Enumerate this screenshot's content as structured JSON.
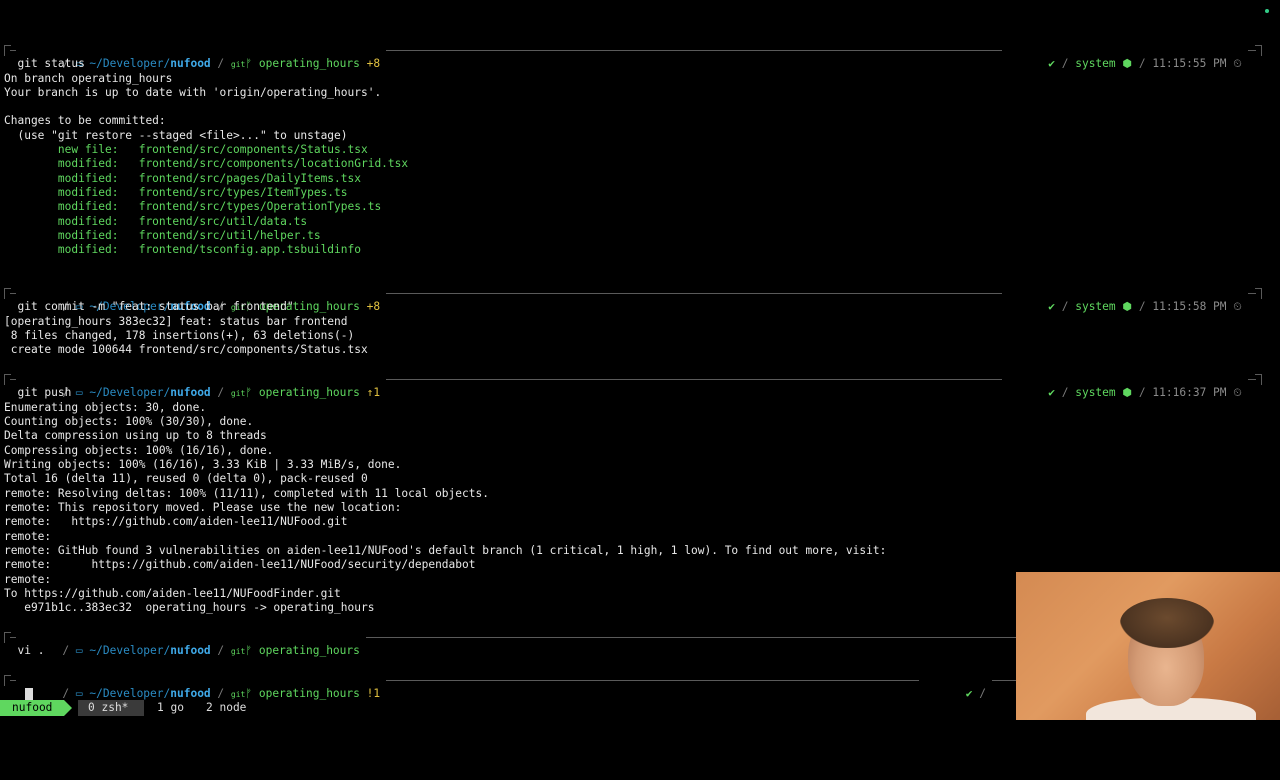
{
  "prompt": {
    "apple": "",
    "home": "~/Developer/",
    "repo": "nufood",
    "sep": "/",
    "git_icon": "git",
    "branch_glyph": "ᚠ",
    "check": "✔",
    "system": "system",
    "node_icon": "⬢",
    "clock": "⏲"
  },
  "blocks": {
    "p1": {
      "branch": "operating_hours",
      "count": "+8",
      "time": "11:15:55 PM",
      "cmd": "git status"
    },
    "p2": {
      "branch": "operating_hours",
      "count": "+8",
      "time": "11:15:58 PM",
      "cmd": "git commit -m \"feat: status bar frontend\""
    },
    "p3": {
      "branch": "operating_hours",
      "count": "↑1",
      "time": "11:16:37 PM",
      "cmd": "git push"
    },
    "p4": {
      "branch": "operating_hours",
      "count": "",
      "time": "",
      "cmd": "vi ."
    },
    "p5": {
      "branch": "operating_hours",
      "count": "!1",
      "time": "",
      "cmd": ""
    }
  },
  "output": {
    "status": [
      "On branch operating_hours",
      "Your branch is up to date with 'origin/operating_hours'.",
      "",
      "Changes to be committed:",
      "  (use \"git restore --staged <file>...\" to unstage)"
    ],
    "staged": [
      "        new file:   frontend/src/components/Status.tsx",
      "        modified:   frontend/src/components/locationGrid.tsx",
      "        modified:   frontend/src/pages/DailyItems.tsx",
      "        modified:   frontend/src/types/ItemTypes.ts",
      "        modified:   frontend/src/types/OperationTypes.ts",
      "        modified:   frontend/src/util/data.ts",
      "        modified:   frontend/src/util/helper.ts",
      "        modified:   frontend/tsconfig.app.tsbuildinfo"
    ],
    "commit": [
      "[operating_hours 383ec32] feat: status bar frontend",
      " 8 files changed, 178 insertions(+), 63 deletions(-)",
      " create mode 100644 frontend/src/components/Status.tsx"
    ],
    "push": [
      "Enumerating objects: 30, done.",
      "Counting objects: 100% (30/30), done.",
      "Delta compression using up to 8 threads",
      "Compressing objects: 100% (16/16), done.",
      "Writing objects: 100% (16/16), 3.33 KiB | 3.33 MiB/s, done.",
      "Total 16 (delta 11), reused 0 (delta 0), pack-reused 0",
      "remote: Resolving deltas: 100% (11/11), completed with 11 local objects.",
      "remote: This repository moved. Please use the new location:",
      "remote:   https://github.com/aiden-lee11/NUFood.git",
      "remote:",
      "remote: GitHub found 3 vulnerabilities on aiden-lee11/NUFood's default branch (1 critical, 1 high, 1 low). To find out more, visit:",
      "remote:      https://github.com/aiden-lee11/NUFood/security/dependabot",
      "remote:",
      "To https://github.com/aiden-lee11/NUFoodFinder.git",
      "   e971b1c..383ec32  operating_hours -> operating_hours"
    ]
  },
  "tmux": {
    "session": "nufood",
    "win0": "0 zsh*",
    "win1": "1 go",
    "win2": "2 node"
  },
  "colors": {
    "accent": "#5fd75f",
    "dir": "#2a8cc4",
    "count": "#e0c040"
  }
}
